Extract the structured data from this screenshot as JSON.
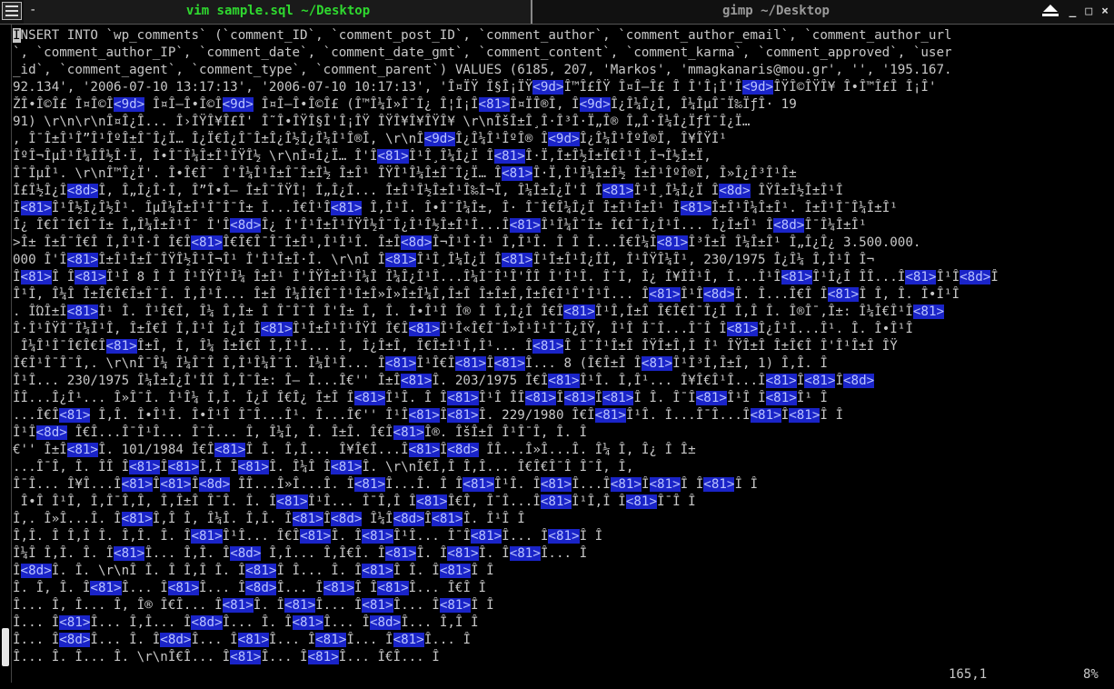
{
  "tabs": [
    {
      "label": "vim sample.sql ~/Desktop",
      "active": true
    },
    {
      "label": "gimp ~/Desktop",
      "active": false
    }
  ],
  "window_controls": [
    "restore",
    "_",
    "□",
    "×"
  ],
  "editor": {
    "lines": [
      "INSERT INTO `wp_comments` (`comment_ID`, `comment_post_ID`, `comment_author`, `comment_author_email`, `comment_author_url",
      "`, `comment_author_IP`, `comment_date`, `comment_date_gmt`, `comment_content`, `comment_karma`, `comment_approved`, `user",
      "_id`, `comment_agent`, `comment_type`, `comment_parent`) VALUES (6185, 207, 'Markos', 'mmagkanaris@mou.gr', '', '195.167.",
      "92.134', '2006-07-10 13:17:13', '2006-07-10 10:17:13', 'Î¤ÏŸ Î§Î¡ÏŸ<9d>Î™Î£ÎŸ Î¤Î–Î£ Î Î'Î¡Î'Î<9d>ÎŸÎ©ÎŸÎ¥ Î•Î™Î£Î Î¡Î'",
      "ŽÎ•Î©Î£ Î¤Î©Î<9d> Î¤Î–Î•Î©Î<9d> Î¤Î–Î•Î©Î£ (Î™Î¼Î»Î¯Î¿ Î¦Î¡Î<81>Î¤ÏÎ®Î, Î<9d>Î¿Î¼Î¿Î, Î¼ÎµÎ¯Ï‰ÏƒÎ· 19",
      "91) \\r\\n\\r\\nÎ¤Î¿Î... Î›ÎŸÎ¥Î£Î' Î˜Î•ÎŸÎ§Î'Î¡ÎŸ ÎŸÎ¥Î¥ÎŸÎ¥ \\r\\nÎšÎ±Î¸Î·Î³Î·Ï„Î® Î„Î·Î¼Î¿ÏƒÎ¯Î¿Ï…",
      ", Î¯Î±Î¹Î”Î¹ÎºÎ±Î¯Î¿Ï… Î¿Ï€Î¿Î¯Î±Î¿Î½Î¿Î¼Î¹Î®Î, \\r\\nÎ<9d>Î¿Î¼Î¹ÎºÎ® Î<9d>Î¿Î¼Î¹ÎºÎ®Ï‚ Î¥ÎŸÎ¹",
      "ÎºÎ¬ÎµÎ¹Î¼Î­Î½Î·Ï‚ Î•Î¯Î¼Î±Î¹ÎŸÎ½ \\r\\nÎ¤Î¿Ï… Î'Î<81>Î¹Î¸Î¼Î¿Ï Î<81>Î·Ï‚Î±Î½Î±Ï€Î¹Î¸Î¬Î½Î±Ï‚",
      "Î¯ÎµÎ¹. \\r\\nÎ™Î¿Ï'. Î•Î€Î¯ Î'Î¼Î¹Î±Î¯Î±Î½ Î±Î¹ ÎŸÎ¹Î¼Î±Î¯Î¿Ï… Î<81>Î·Ï‚Î¹Î¼Î±Î½ Î±Î¹ÎºÎ®Ï‚ Î»Î¿Î³Î¹Î±",
      "Î£Î½Î¿Î<8d>Î, Î„Î¿Î·Î, Î”Î•Î– Î±Î¯ÎŸÎ¦ Î„Î¿Î... Î±Î¹Î½Î±Î¹Î‰Î¬Ï‚ Î¼Î±Î¿Ï'Î Î<81>Î¹Î¸Î¼Î¿Ï Î<8d> ÎŸÎ±Î½Î±Î¹Î",
      "Î<81>Î¹Î½Î¿Î½Î¹. ÎµÎ¼Î±Î¹Î¯Î¯Î± Î...Î€Î¹Î<81> Î,Î¹Î. Î•Î¯Î¼Î±, Î· Î¯Î€Î¼Î¿Ï Î±Î¹Î±Î¹ Î<81>Î±Î¹Î¼Î±Î¹. Î±Î¹Î¯Î¼Î±Î¹",
      "Î¿ Î€Î¯Î€Î¯Î± Î„Î¼Î±Î¹Î¯ Î'Î<8d>Î¿ Î'Î¹Î±Î¹ÎŸÎ½Î¯Î¿Î¹Î½Î±Î¹Î...Î<81>Î¹Î¼Î¯Î± Î€Î¯Î¿Î¹Î... Î¿Î±Î¹ Î<8d>Î¯Î¼Î±Î¹",
      ">Î± Î±Î¯Î€Î Î,Î¹Î·Î Î€Î<81>Î€Î€Î¯Î¯Î±Î¹,Î¹Î¹Î. Î±Î<8d>Î¬Î¹Î·Î¹ Î,Î¹Î. Î Î Î...Î€Î¼Î<81>Î³Î±Î Î¼Î±Î¹ Î„Î¿Î¿ 3.500.000.",
      "000 Î'Î<81>Î±Î¹Î±Î¯ÎŸÎ½Î¹Î¬Î¹ Î'Î¹Î±Î·Î. \\r\\nÎ Î<81>Î¹Î¸Î¼Î¿Ï Î<81>Î¹Î±Î¹Î¿ÎÎ, Î¹ÎŸÎ¼Î¹, 230/1975 Î¿Î¼ Î,Î¹Î Î¬",
      "Î<81>Î Î<81>Î¹Î 8 Î Î Î¹ÎŸÎ¹Î¼ Î±Î¹ Î'ÎŸÎ±Î¹Î¼Î Î¼Î¿Î¹Î...Î¼Î¯Î¹Î'ÎÎ Î'Î¹Î. Î¯Î, Î¿ Î¥ÎÎ¹Î, Î...Î¹Î<81>Î¹Î¿Î ÎÎ...Î<81>Î¹Î<8d>Î",
      "Î¹Î, Î¼Î Î±Î€Î€Î±Î¯Î. Î,Î¹Î... Î±Î Î¼ÎÎ€Î¯Î¹Î±Î»Î»Î±Î¼Î,Î±Î Î±Î±Î,Î±Î€Î¹Î'Î¹Î... Î<81>Î¹Î<8d>Î. Î...Î€Î Î<81>Î Î, Î. Î•Î¹Î",
      ". ÎΏÎ±Î<81>Î¹ Î. Î¹Î€Î, Î¼ Î,Î± Î Î¯Î¯Î Î'Î± Î, Î. Î•Î¹Î Î® Î Î,Î¿Î Î€Î<81>Î¹Î,Î±Î Î€Î€Î¯Î¿Î Î,Î Î. Î®Î¯,Î±: Î¼Î€Î¹Î<81>",
      "Î·Î¹ÎŸÎ¯Î¼Î¹Î, Î±Î€Î Î,Î¹Î Î¿Î Î<81>Î¹Î±Î¹Î¹ÎŸÎ Î€Î<81>Î¹Î«Î€Î¯Î»Î¹Î¹Î¯Î¿ÎŸ, Î¹Î Î¯Î...Î¯Î Î<81>Î¿Î¹Î...Î¹. Î. Î•Î¹Î",
      " Î¼Î¹Î¯Î€Î€Î<81>Î±Î, Î, Î¼ Î±Î€Î Î,Î¹Î... Î, Î¿Î±Î, Î€Î±Î¹Î,Î¹... Î<81>Î Î¯Î¹Î±Î ÎŸÎ±Î,Î Î¹ ÎŸÎ±Î Î±Î€Î Î'Î¹Î±Î ÎŸ",
      "Î€Î¹Î¯Î¯Î,. \\r\\nÎ¯Î¼ Î¼Î¯Î Î,Î¹Î¼Î¯Î. Î¼Î¹Î... Î<81>Î¹Î€Î<81>Î<81>Î... 8 (Î€Î±Î Î<81>Î¹Î³Î,Î±Î, 1) Î,Î. Î",
      "Î¹Î... 230/1975 Î¼Î±Î¿Î'ÎÎ Î,Î¯Î±: Î– Î...Î€'' Î±Î<81>Î. 203/1975 Î€Î<81>Î¹Î. Î,Î¹... Î¥Î€Î¹Î...Î<81>Î<81>Î<8d>",
      "ÎÎ...Î¿Î¹... Î»Î¯Î. Î¹Î¼ Î,Î. Î¿Î Î€Î¿ Î±Î Î<81>Î¹Î. Î Î<81>Î¹Î ÎÎ<81>Î<81>Î<81>Î Î. Î¯Î<81>Î¹Î Î<81>Î¹ Î",
      "...Î€Î<81> Î,Î. Î•Î¹Î. Î•Î¹Î Î¯Î...Î¹. Î...Î€'' Î¹Î<81>Î<81>Î. 229/1980 Î€Î<81>Î¹Î. Î...Î¯Î...Î<81>Î<81>Î Î",
      "Î¹Î<8d> Î€Î...Î¯Î¹Î... Î¯Î... Î, Î¼Î, Î. Î±Î. Î€Î<81>Î®. ÎšÎ±Î Î¹Î¯Î, Î. Î",
      "€'' Î±Î<81>Î. 101/1984 Î€Î<81>Î Î. Î,Î... Î¥Î€Î...Î<81>Î<8d> ÎÎ...Î»Î...Î. Î¼ Î, Î¿ Î Î±",
      "...Î¯Î, Î. ÎÎ Î<81>Î<81>Î,Î Î<81>Î. Î¼Î Î<81>Î. \\r\\nÎ€Î,Î Î,Î... Î€Î€Î¯Î Î¯Î, Î,",
      "Î¯Î... Î¥Î...Î<81>Î<81>Î<8d> ÎÎ...Î»Î...Î. Î<81>Î...Î. Î Î<81>Î¹Î. Î<81>Î...Î<81>Î<81>Î Î<81>Î Î",
      " Î•Î Î¹Î, Î,Î¯Î,Î, Î,Î±Î Î¯Î. Î. Î<81>Î¹Î... Î¯Î,Î Î<81>Î€Î, Î¯Î...Î<81>Î¹Î,Î Î<81>Î¯Î Î",
      "Î,. Î»Î...Î. Î<81>Î,Î Î, Î¼Î. Î,Î. Î<81>Î<8d> Î¼Î<8d>Î<81>Î. Î¹Î Î",
      "Î,Î. Î Î,Î Î. Î,Î. Î. Î<81>Î¹Î... Î€Î<81>Î. Î<81>Î¹Î... Î¯Î<81>Î... Î<81>Î Î",
      "Î¼Î Î,Î. Î. Î<81>Î... Î,Î. Î<8d> Î,Î... Î,Î€Î. Î<81>Î. Î<81>Î. Î<81>Î... Î",
      "Î<8d>Î. Î. \\r\\nÎ Î. Î Î,Î Î. Î<81>Î Î... Î. Î<81>Î Î. Î<81>Î Î",
      "Î. Î, Î. Î<81>Î... Î<81>Î... Î<8d>Î... Î<81>Î Î<81>Î... Î€Î Î",
      "Î... Î, Î... Î, Î® Î€Î... Î<81>Î. Î<81>Î... Î<81>Î... Î<81>Î Î",
      "Î... Î<81>Î... Î,Î... Î<8d>Î... Î. Î<81>Î... Î<8d>Î... Î,Î Î",
      "Î... Î<8d>Î... Î. Î<8d>Î... Î<81>Î... Î<81>Î... Î<81>Î... Î",
      "Î... Î. Î... Î. \\r\\nÎ€Î... Î<81>Î... Î<81>Î... Î€Î... Î"
    ]
  },
  "status": {
    "position": "165,1",
    "percent": "8%"
  }
}
